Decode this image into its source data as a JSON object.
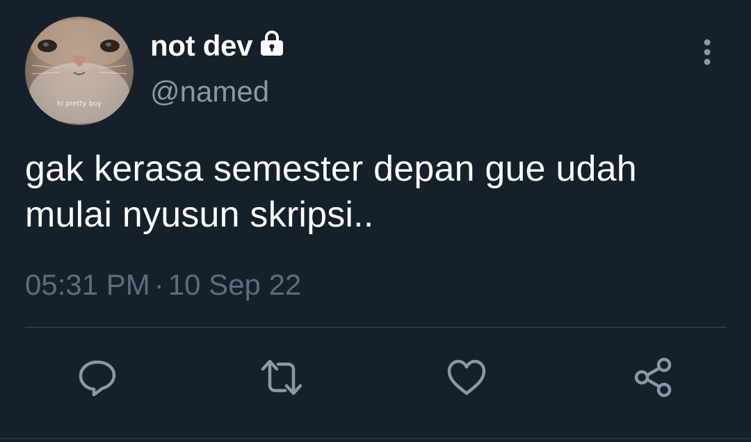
{
  "author": {
    "display_name": "not dev",
    "username": "@named",
    "avatar_caption": "hi pretty boy",
    "protected_icon": "lock-icon"
  },
  "tweet": {
    "text": "gak kerasa semester depan gue udah mulai nyusun skripsi..",
    "time": "05:31 PM",
    "separator": "·",
    "date": "10 Sep 22"
  },
  "actions": [
    {
      "name": "reply",
      "icon": "comment-icon"
    },
    {
      "name": "retweet",
      "icon": "retweet-icon"
    },
    {
      "name": "like",
      "icon": "heart-icon"
    },
    {
      "name": "share",
      "icon": "share-icon"
    }
  ],
  "colors": {
    "background": "#15202b",
    "primary_text": "#ffffff",
    "secondary_text": "#8899a6",
    "timestamp_text": "#5c6d7c",
    "icon": "#8899a6",
    "divider": "#2c3945"
  }
}
